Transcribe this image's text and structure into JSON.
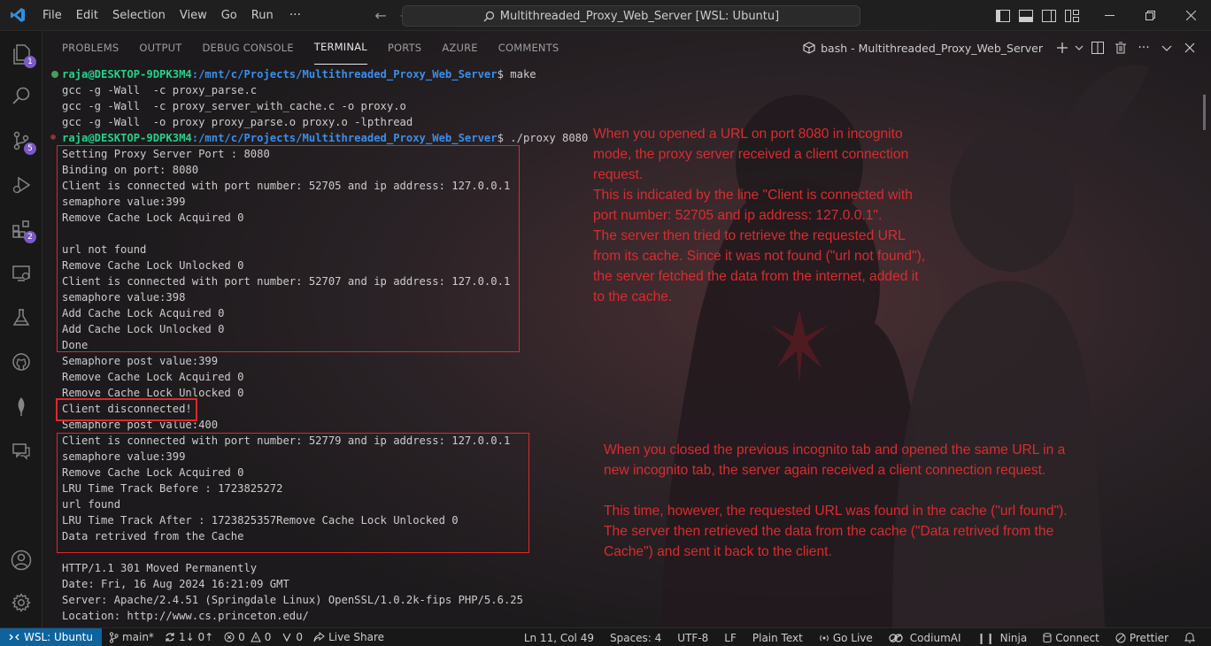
{
  "menu": [
    "File",
    "Edit",
    "Selection",
    "View",
    "Go",
    "Run"
  ],
  "menu_more": "···",
  "window_title": "Multithreaded_Proxy_Web_Server [WSL: Ubuntu]",
  "activity_badges": {
    "explorer": "1",
    "scm": "5",
    "extensions": "2"
  },
  "panel_tabs": [
    "PROBLEMS",
    "OUTPUT",
    "DEBUG CONSOLE",
    "TERMINAL",
    "PORTS",
    "AZURE",
    "COMMENTS"
  ],
  "active_tab": "TERMINAL",
  "terminal_name": "bash - Multithreaded_Proxy_Web_Server",
  "terminal": {
    "prompt1_user": "raja@DESKTOP-9DPK3M4",
    "prompt1_path": ":/mnt/c/Projects/Multithreaded_Proxy_Web_Server",
    "prompt1_cmd": "$ make",
    "build_lines": [
      "gcc -g -Wall  -c proxy_parse.c",
      "gcc -g -Wall  -c proxy_server_with_cache.c -o proxy.o",
      "gcc -g -Wall  -o proxy proxy_parse.o proxy.o -lpthread"
    ],
    "prompt2_user": "raja@DESKTOP-9DPK3M4",
    "prompt2_path": ":/mnt/c/Projects/Multithreaded_Proxy_Web_Server",
    "prompt2_cmd": "$ ./proxy 8080",
    "output_lines": [
      "Setting Proxy Server Port : 8080",
      "Binding on port: 8080",
      "Client is connected with port number: 52705 and ip address: 127.0.0.1",
      "semaphore value:399",
      "Remove Cache Lock Acquired 0",
      "",
      "url not found",
      "Remove Cache Lock Unlocked 0",
      "Client is connected with port number: 52707 and ip address: 127.0.0.1",
      "semaphore value:398",
      "Add Cache Lock Acquired 0",
      "Add Cache Lock Unlocked 0",
      "Done",
      "Semaphore post value:399",
      "Remove Cache Lock Acquired 0",
      "Remove Cache Lock Unlocked 0",
      "Client disconnected!",
      "Semaphore post value:400",
      "Client is connected with port number: 52779 and ip address: 127.0.0.1",
      "semaphore value:399",
      "Remove Cache Lock Acquired 0",
      "LRU Time Track Before : 1723825272",
      "url found",
      "LRU Time Track After : 1723825357Remove Cache Lock Unlocked 0",
      "Data retrived from the Cache",
      "",
      "HTTP/1.1 301 Moved Permanently",
      "Date: Fri, 16 Aug 2024 16:21:09 GMT",
      "Server: Apache/2.4.51 (Springdale Linux) OpenSSL/1.0.2k-fips PHP/5.6.25",
      "Location: http://www.cs.princeton.edu/"
    ]
  },
  "annotation1": [
    "When you opened a URL on port 8080 in incognito",
    "mode, the proxy server received a client connection",
    "request.",
    "This is indicated by the line \"Client is connected with",
    "port number: 52705 and ip address: 127.0.0.1\".",
    "The server then tried to retrieve the requested URL",
    "from its cache. Since it was not found (\"url not found\"),",
    "the server fetched the data from the internet, added it",
    "to the cache."
  ],
  "annotation2": [
    "When you closed the previous incognito tab and opened the same URL in a",
    "new incognito tab, the server again received a client connection request.",
    "",
    "This time, however, the requested URL was found in the cache (\"url found\").",
    "The server then retrieved the data from the cache (\"Data retrived from the",
    "Cache\") and sent it back to the client."
  ],
  "status": {
    "remote": "WSL: Ubuntu",
    "branch": "main*",
    "sync": "1↓ 0↑",
    "errors": "0",
    "warnings": "0",
    "ports": "0",
    "live_share": "Live Share",
    "position": "Ln 11, Col 49",
    "spaces": "Spaces: 4",
    "encoding": "UTF-8",
    "eol": "LF",
    "language": "Plain Text",
    "go_live": "Go Live",
    "codium": "CodiumAI",
    "ninja": "Ninja",
    "connect": "Connect",
    "prettier": "Prettier"
  },
  "colors": {
    "accent": "#0e639c",
    "annotation_red": "#d92c2f",
    "prompt_green": "#23d18b",
    "prompt_blue": "#3b8eea"
  }
}
